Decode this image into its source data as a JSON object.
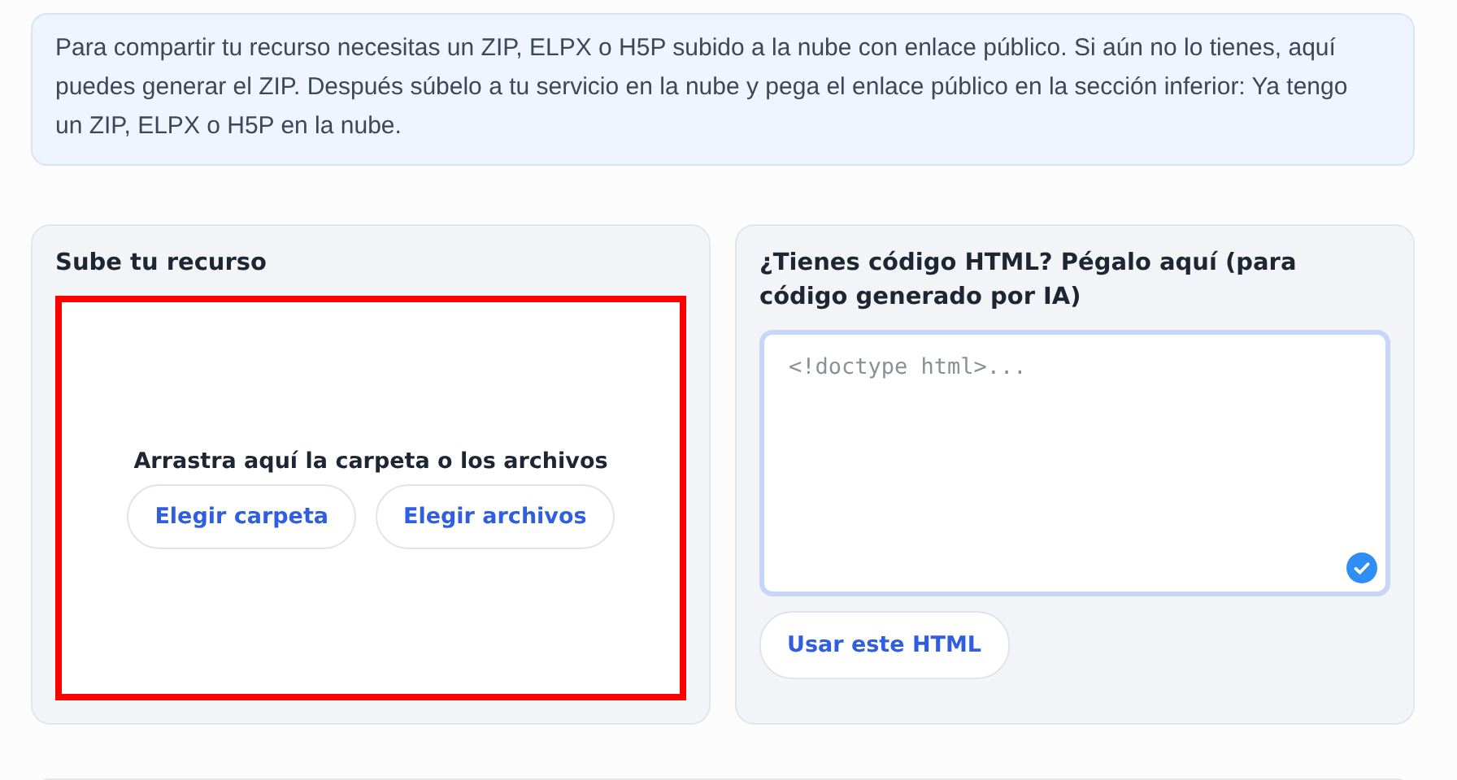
{
  "notice": "Para compartir tu recurso necesitas un ZIP, ELPX o H5P subido a la nube con enlace público. Si aún no lo tienes, aquí puedes generar el ZIP. Después súbelo a tu servicio en la nube y pega el enlace público en la sección inferior: Ya tengo un ZIP, ELPX o H5P en la nube.",
  "upload": {
    "title": "Sube tu recurso",
    "dropzone": {
      "highlighted": true,
      "text": "Arrastra aquí la carpeta o los archivos",
      "buttons": [
        "Elegir carpeta",
        "Elegir archivos"
      ]
    }
  },
  "html": {
    "title": "¿Tienes código HTML? Pégalo aquí (para código generado por IA)",
    "field": {
      "placeholder": "<!doctype html>...",
      "focused": true,
      "validated": true
    },
    "button": "Usar este HTML"
  }
}
